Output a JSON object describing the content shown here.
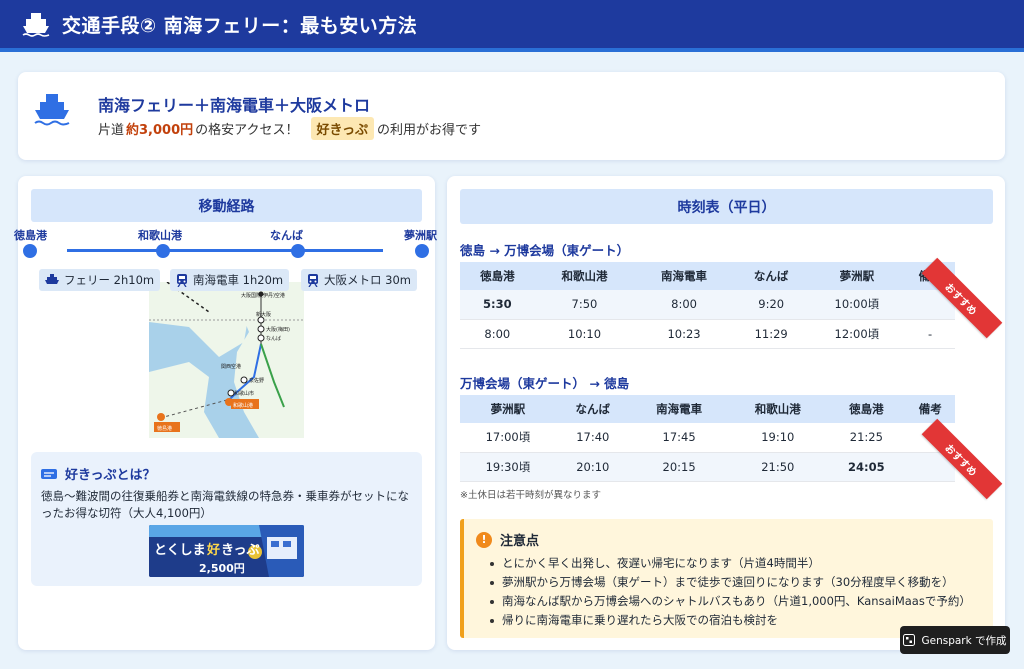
{
  "header": {
    "title": "交通手段② 南海フェリー：最も安い方法"
  },
  "hero": {
    "title": "南海フェリー＋南海電車＋大阪メトロ",
    "sub_prefix": "片道",
    "price": "約3,000円",
    "sub_mid": "の格安アクセス！",
    "tag": "好きっぷ",
    "sub_suffix": "の利用がお得です"
  },
  "route": {
    "header": "移動経路",
    "stations": [
      "徳島港",
      "和歌山港",
      "なんば",
      "夢洲駅"
    ],
    "segments": [
      {
        "label": "フェリー 2h10m",
        "icon": "ship-icon"
      },
      {
        "label": "南海電車 1h20m",
        "icon": "train-icon"
      },
      {
        "label": "大阪メトロ 30m",
        "icon": "metro-icon"
      }
    ],
    "map_labels": [
      "大阪国際(伊丹)空港",
      "新大阪",
      "大阪(梅田)",
      "なんば",
      "関西空港",
      "泉佐野",
      "和歌山港",
      "徳島港",
      "和歌山市"
    ]
  },
  "kippu": {
    "title": "好きっぷとは？",
    "body": "徳島～難波間の往復乗船券と南海電鉄線の特急券・乗車券がセットになったお得な切符（大人4,100円）",
    "ticket_brand": "とくしま",
    "ticket_brand_accent": "好",
    "ticket_brand_tail": "きっぷ",
    "ticket_price": "2,500円"
  },
  "timetable": {
    "header": "時刻表（平日）",
    "outbound_title": "徳島 → 万博会場（東ゲート）",
    "outbound_cols": [
      "徳島港",
      "和歌山港",
      "南海電車",
      "なんば",
      "夢洲駅",
      "備考"
    ],
    "outbound_rows": [
      [
        "5:30",
        "7:50",
        "8:00",
        "9:20",
        "10:00頃",
        ""
      ],
      [
        "8:00",
        "10:10",
        "10:23",
        "11:29",
        "12:00頃",
        "-"
      ]
    ],
    "inbound_title": "万博会場（東ゲート） → 徳島",
    "inbound_cols": [
      "夢洲駅",
      "なんば",
      "南海電車",
      "和歌山港",
      "徳島港",
      "備考"
    ],
    "inbound_rows": [
      [
        "17:00頃",
        "17:40",
        "17:45",
        "19:10",
        "21:25",
        "-"
      ],
      [
        "19:30頃",
        "20:10",
        "20:15",
        "21:50",
        "24:05",
        ""
      ]
    ],
    "recommend_label": "おすすめ",
    "footnote": "※土休日は若干時刻が異なります"
  },
  "caution": {
    "title": "注意点",
    "items": [
      "とにかく早く出発し、夜遅い帰宅になります（片道4時間半）",
      "夢洲駅から万博会場（東ゲート）まで徒歩で遠回りになります（30分程度早く移動を）",
      "南海なんば駅から万博会場へのシャトルバスもあり（片道1,000円、KansaiMaasで予約）",
      "帰りに南海電車に乗り遅れたら大阪での宿泊も検討を"
    ]
  },
  "badge": {
    "label": "Genspark で作成"
  },
  "colors": {
    "primary": "#1e3a9e",
    "accent_line": "#2f6fe4",
    "price": "#c2410c",
    "ribbon": "#e23636",
    "caution_border": "#f0a01c"
  }
}
